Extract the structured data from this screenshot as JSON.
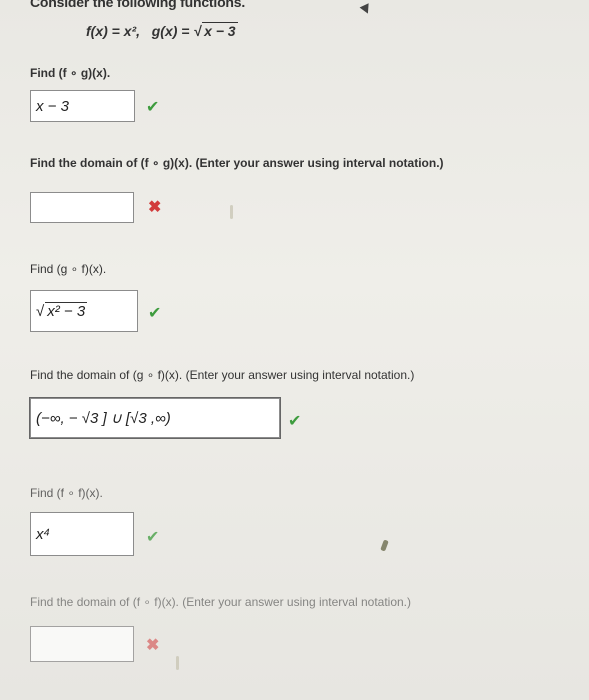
{
  "header": {
    "title": "Consider the following functions.",
    "f_def": "f(x) = x²,",
    "g_def_prefix": "g(x) = ",
    "g_def_radicand": "x − 3"
  },
  "questions": [
    {
      "prompt": "Find (f ∘ g)(x).",
      "answer": "x − 3",
      "status": "correct"
    },
    {
      "prompt": "Find the domain of (f ∘ g)(x). (Enter your answer using interval notation.)",
      "answer": "",
      "status": "incorrect"
    },
    {
      "prompt": "Find (g ∘ f)(x).",
      "answer_radicand": "x² − 3",
      "status": "correct"
    },
    {
      "prompt": "Find the domain of (g ∘ f)(x). (Enter your answer using interval notation.)",
      "answer": "(−∞, − √3 ] ∪ [√3 ,∞)",
      "status": "correct"
    },
    {
      "prompt": "Find (f ∘ f)(x).",
      "answer": "x⁴",
      "status": "correct"
    },
    {
      "prompt": "Find the domain of (f ∘ f)(x). (Enter your answer using interval notation.)",
      "answer": "",
      "status": "incorrect"
    }
  ],
  "icons": {
    "correct": "✔",
    "incorrect": "✖"
  },
  "colors": {
    "correct": "#3e9c3e",
    "incorrect": "#d23c3c",
    "background": "#ecebe6"
  }
}
